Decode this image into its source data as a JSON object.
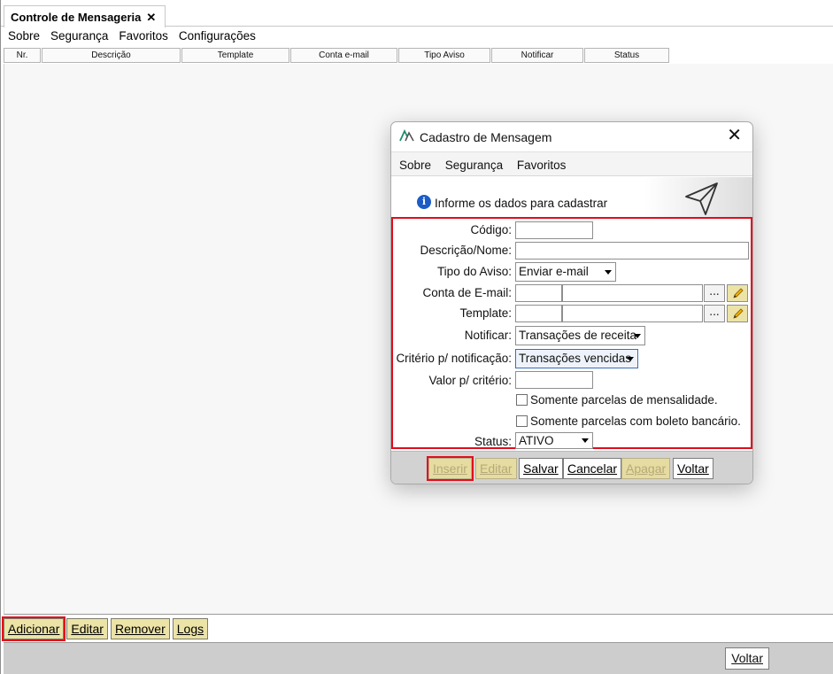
{
  "window": {
    "tab_title": "Controle de Mensageria",
    "tab_close": "✕"
  },
  "menu": [
    "Sobre",
    "Segurança",
    "Favoritos",
    "Configurações"
  ],
  "grid": {
    "columns": [
      "Nr.",
      "Descrição",
      "Template",
      "Conta e-mail",
      "Tipo Aviso",
      "Notificar",
      "Status"
    ]
  },
  "actions": {
    "add": "Adicionar",
    "edit": "Editar",
    "remove": "Remover",
    "logs": "Logs"
  },
  "footer": {
    "back": "Voltar"
  },
  "dialog": {
    "title": "Cadastro de Mensagem",
    "close": "✕",
    "menu": [
      "Sobre",
      "Segurança",
      "Favoritos"
    ],
    "info_text": "Informe os dados para cadastrar",
    "info_glyph": "i",
    "fields": {
      "codigo_label": "Código:",
      "codigo_value": "",
      "descricao_label": "Descrição/Nome:",
      "descricao_value": "",
      "tipo_label": "Tipo do Aviso:",
      "tipo_value": "Enviar e-mail",
      "conta_label": "Conta de E-mail:",
      "conta_code": "",
      "conta_name": "",
      "template_label": "Template:",
      "template_code": "",
      "template_name": "",
      "browse_label": "...",
      "notificar_label": "Notificar:",
      "notificar_value": "Transações de receita",
      "criterio_label": "Critério p/ notificação:",
      "criterio_value": "Transações vencidas",
      "valor_label": "Valor p/ critério:",
      "valor_value": "",
      "chk_mensalidade_label": "Somente parcelas de mensalidade.",
      "chk_mensalidade_checked": false,
      "chk_boleto_label": "Somente parcelas com boleto bancário.",
      "chk_boleto_checked": false,
      "status_label": "Status:",
      "status_value": "ATIVO"
    },
    "buttons": {
      "inserir": "Inserir",
      "editar": "Editar",
      "salvar": "Salvar",
      "cancelar": "Cancelar",
      "apagar": "Apagar",
      "voltar": "Voltar"
    }
  },
  "colors": {
    "highlight": "#e00d1c",
    "button_yellow": "#ece3a7",
    "info_blue": "#1b5cc6",
    "logo_green": "#1e8c6e"
  },
  "icons": [
    "close-icon",
    "info-icon",
    "paper-plane-icon",
    "pencil-icon",
    "app-logo-icon",
    "chevron-down-icon"
  ]
}
